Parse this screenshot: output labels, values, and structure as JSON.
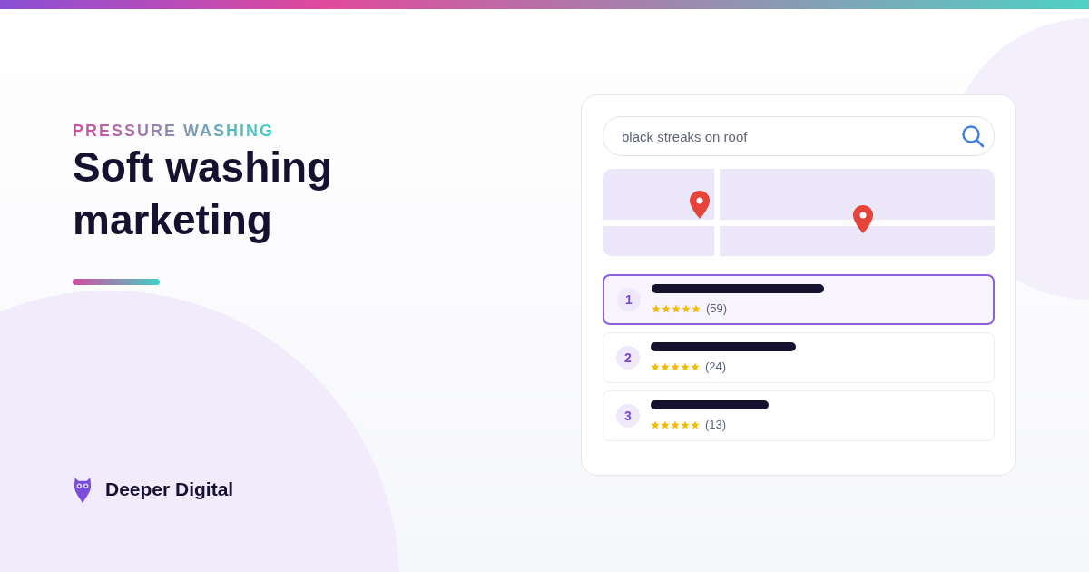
{
  "eyebrow": "PRESSURE WASHING",
  "headline": "Soft washing marketing",
  "brand": {
    "name": "Deeper Digital"
  },
  "search": {
    "value": "black streaks on roof"
  },
  "results": [
    {
      "rank": "1",
      "selected": true,
      "stars": 5,
      "reviews": "(59)"
    },
    {
      "rank": "2",
      "selected": false,
      "stars": 5,
      "reviews": "(24)"
    },
    {
      "rank": "3",
      "selected": false,
      "stars": 5,
      "reviews": "(13)"
    }
  ]
}
